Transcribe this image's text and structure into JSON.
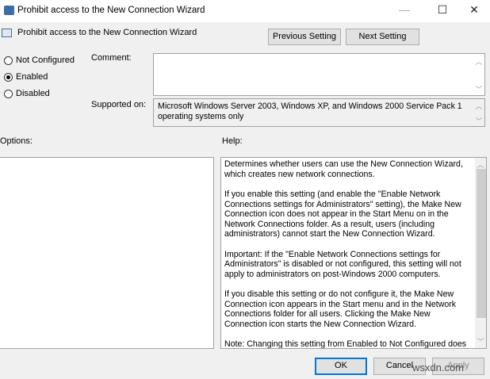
{
  "window": {
    "title": "Prohibit access to the New Connection Wizard",
    "minimize": "—",
    "maximize": "☐",
    "close": "✕"
  },
  "header": {
    "setting_name": "Prohibit access to the New Connection Wizard",
    "prev_label": "Previous Setting",
    "next_label": "Next Setting"
  },
  "state": {
    "options": [
      {
        "label": "Not Configured",
        "selected": false
      },
      {
        "label": "Enabled",
        "selected": true
      },
      {
        "label": "Disabled",
        "selected": false
      }
    ]
  },
  "comment": {
    "label": "Comment:",
    "value": ""
  },
  "supported": {
    "label": "Supported on:",
    "value": "Microsoft Windows Server 2003, Windows XP, and Windows 2000 Service Pack 1 operating systems only"
  },
  "options_label": "Options:",
  "help_label": "Help:",
  "help_paragraphs": [
    "Determines whether users can use the New Connection Wizard, which creates new network connections.",
    "If you enable this setting (and enable the \"Enable Network Connections settings for Administrators\" setting), the Make New Connection icon does not appear in the Start Menu on in the Network Connections folder. As a result, users (including administrators) cannot start the New Connection Wizard.",
    "Important: If the \"Enable Network Connections settings for Administrators\" is disabled or not configured, this setting will not apply to administrators on post-Windows 2000 computers.",
    "If you disable this setting or do not configure it, the Make New Connection icon appears in the Start menu and in the Network Connections folder for all users. Clicking the Make New Connection icon starts the New Connection Wizard.",
    "Note: Changing this setting from Enabled to Not Configured does not restore the Make New Connection icon until the user logs off or on. When other changes to this setting are applied, the icon does not appear until a new window is opened."
  ],
  "footer": {
    "ok": "OK",
    "cancel": "Cancel",
    "apply": "Apply"
  },
  "watermark": "wsxdn.com"
}
